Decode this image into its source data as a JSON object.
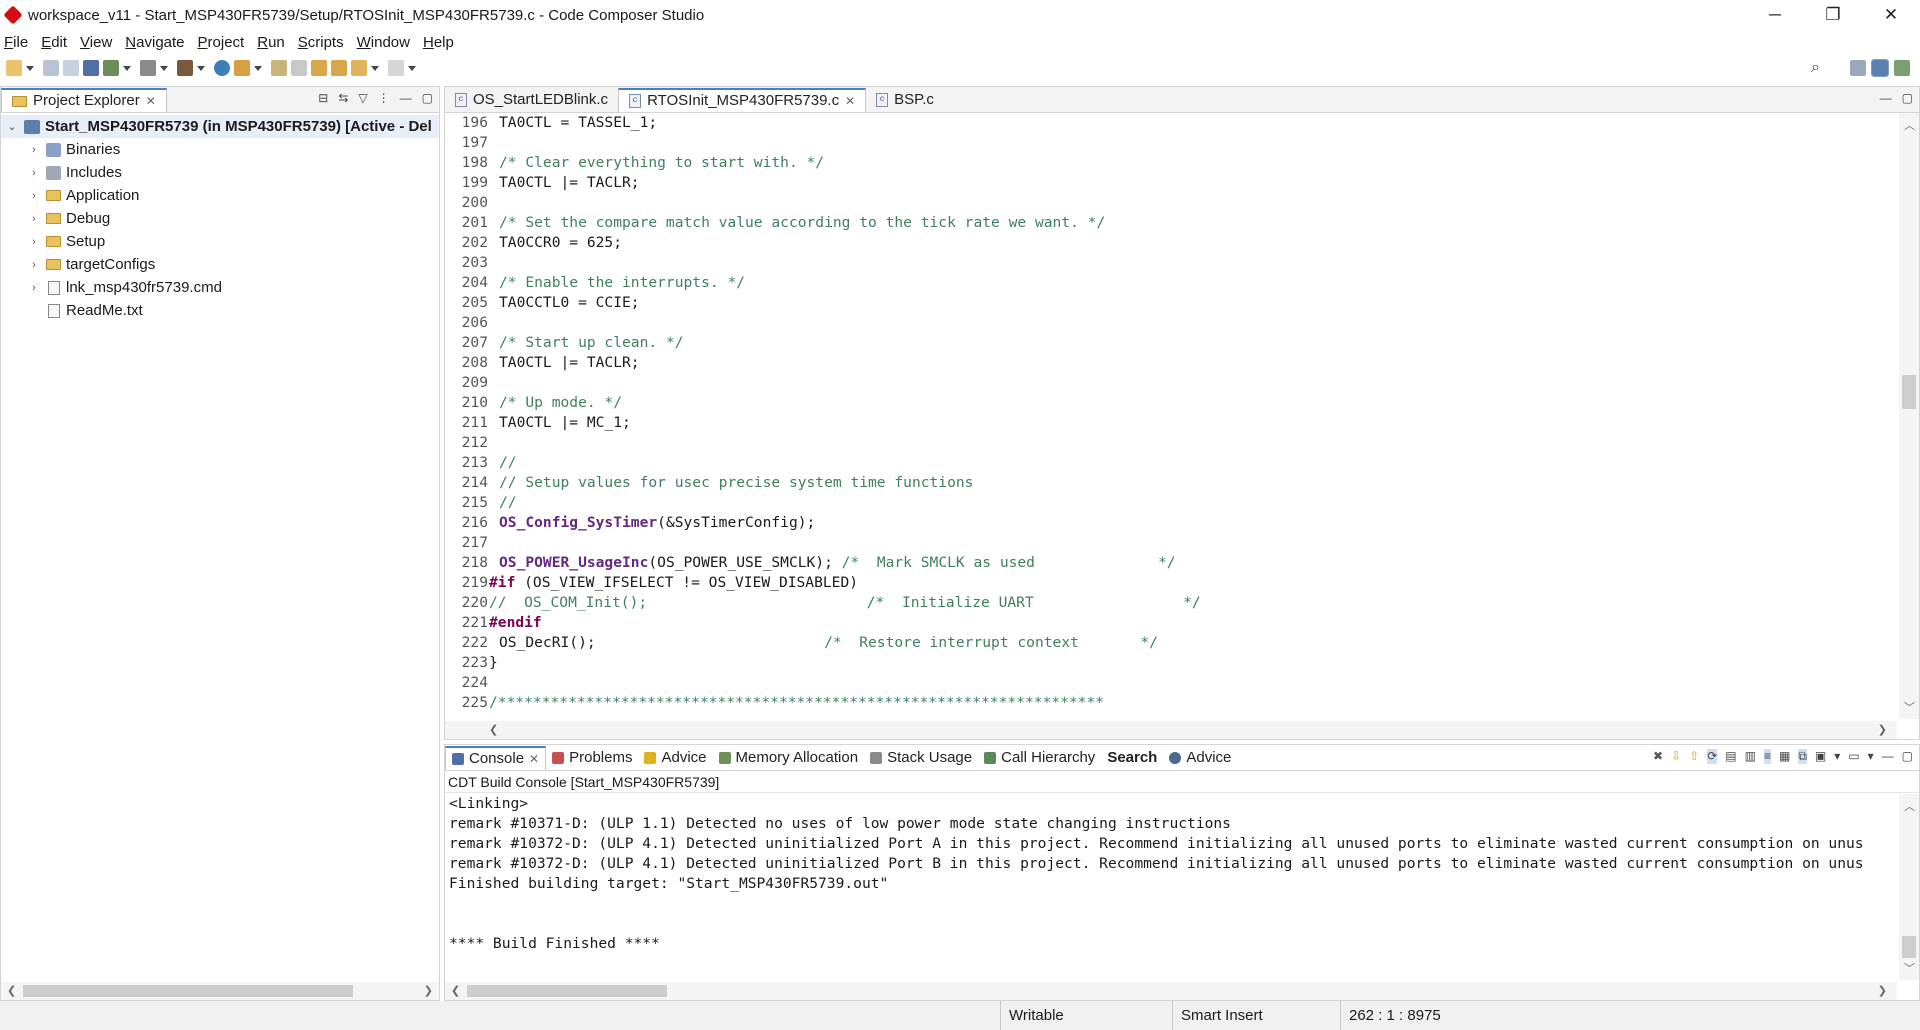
{
  "window": {
    "title": "workspace_v11 - Start_MSP430FR5739/Setup/RTOSInit_MSP430FR5739.c - Code Composer Studio",
    "minimize": "─",
    "maximize": "❐",
    "close": "✕"
  },
  "menu": [
    "File",
    "Edit",
    "View",
    "Navigate",
    "Project",
    "Run",
    "Scripts",
    "Window",
    "Help"
  ],
  "explorer": {
    "tab": "Project Explorer",
    "tab_close": "✕",
    "project": "Start_MSP430FR5739 (in MSP430FR5739)  [Active - Del",
    "items": [
      {
        "label": "Binaries",
        "icon": "binaries-icon",
        "expandable": true
      },
      {
        "label": "Includes",
        "icon": "includes-icon",
        "expandable": true
      },
      {
        "label": "Application",
        "icon": "folder-icon",
        "expandable": true
      },
      {
        "label": "Debug",
        "icon": "folder-icon",
        "expandable": true
      },
      {
        "label": "Setup",
        "icon": "folder-icon",
        "expandable": true
      },
      {
        "label": "targetConfigs",
        "icon": "folder-icon",
        "expandable": true
      },
      {
        "label": "lnk_msp430fr5739.cmd",
        "icon": "file-icon",
        "expandable": true
      },
      {
        "label": "ReadMe.txt",
        "icon": "file-icon",
        "expandable": false
      }
    ]
  },
  "editor": {
    "tabs": [
      {
        "label": "OS_StartLEDBlink.c",
        "active": false
      },
      {
        "label": "RTOSInit_MSP430FR5739.c",
        "active": true,
        "close": "✕"
      },
      {
        "label": "BSP.c",
        "active": false
      }
    ],
    "lines": [
      {
        "n": "196",
        "text": "TA0CTL = TASSEL_1;",
        "type": "code"
      },
      {
        "n": "197",
        "text": "",
        "type": "code"
      },
      {
        "n": "198",
        "text": "/* Clear everything to start with. */",
        "type": "cmt"
      },
      {
        "n": "199",
        "text": "TA0CTL |= TACLR;",
        "type": "code"
      },
      {
        "n": "200",
        "text": "",
        "type": "code"
      },
      {
        "n": "201",
        "text": "/* Set the compare match value according to the tick rate we want. */",
        "type": "cmt"
      },
      {
        "n": "202",
        "text": "TA0CCR0 = 625;",
        "type": "code"
      },
      {
        "n": "203",
        "text": "",
        "type": "code"
      },
      {
        "n": "204",
        "text": "/* Enable the interrupts. */",
        "type": "cmt"
      },
      {
        "n": "205",
        "text": "TA0CCTL0 = CCIE;",
        "type": "code"
      },
      {
        "n": "206",
        "text": "",
        "type": "code"
      },
      {
        "n": "207",
        "text": "/* Start up clean. */",
        "type": "cmt"
      },
      {
        "n": "208",
        "text": "TA0CTL |= TACLR;",
        "type": "code"
      },
      {
        "n": "209",
        "text": "",
        "type": "code"
      },
      {
        "n": "210",
        "text": "/* Up mode. */",
        "type": "cmt"
      },
      {
        "n": "211",
        "text": "TA0CTL |= MC_1;",
        "type": "code"
      },
      {
        "n": "212",
        "text": "",
        "type": "code"
      },
      {
        "n": "213",
        "text": "//",
        "type": "cmt"
      },
      {
        "n": "214",
        "text": "// Setup values for usec precise system time functions",
        "type": "cmt"
      },
      {
        "n": "215",
        "text": "//",
        "type": "cmt"
      },
      {
        "n": "216",
        "text": "OS_Config_SysTimer(&SysTimerConfig);",
        "type": "call",
        "fn": "OS_Config_SysTimer",
        "rest": "(&SysTimerConfig);"
      },
      {
        "n": "217",
        "text": "",
        "type": "code"
      },
      {
        "n": "218",
        "text": "OS_POWER_UsageInc(OS_POWER_USE_SMCLK); /*  Mark SMCLK as used              */",
        "type": "callcmt",
        "fn": "OS_POWER_UsageInc",
        "rest": "(OS_POWER_USE_SMCLK); ",
        "cmt": "/*  Mark SMCLK as used              */"
      },
      {
        "n": "219",
        "text": "#if (OS_VIEW_IFSELECT != OS_VIEW_DISABLED)",
        "type": "pp",
        "kw": "#if",
        "rest": " (OS_VIEW_IFSELECT != OS_VIEW_DISABLED)"
      },
      {
        "n": "220",
        "text": "//  OS_COM_Init();                         /*  Initialize UART                 */",
        "type": "ppcmt"
      },
      {
        "n": "221",
        "text": "#endif",
        "type": "ppkw"
      },
      {
        "n": "222",
        "text": "OS_DecRI();                          /*  Restore interrupt context       */",
        "type": "codecmt",
        "code": "OS_DecRI();                          ",
        "cmt": "/*  Restore interrupt context       */"
      },
      {
        "n": "223",
        "text": "}",
        "type": "pptext"
      },
      {
        "n": "224",
        "text": "",
        "type": "code"
      },
      {
        "n": "225",
        "text": "/*********************************************************************",
        "type": "ppcmt"
      }
    ]
  },
  "console": {
    "tabs": [
      {
        "label": "Console",
        "icon": "console-icon",
        "active": true
      },
      {
        "label": "Problems",
        "icon": "problems-icon"
      },
      {
        "label": "Advice",
        "icon": "bulb-icon"
      },
      {
        "label": "Memory Allocation",
        "icon": "memory-icon"
      },
      {
        "label": "Stack Usage",
        "icon": "stack-icon"
      },
      {
        "label": "Call Hierarchy",
        "icon": "hierarchy-icon"
      },
      {
        "label": "Search",
        "icon": "",
        "bold": true
      },
      {
        "label": "Advice",
        "icon": "globe-icon"
      }
    ],
    "subtitle": "CDT Build Console [Start_MSP430FR5739]",
    "lines": [
      "<Linking>",
      "remark #10371-D: (ULP 1.1) Detected no uses of low power mode state changing instructions",
      "remark #10372-D: (ULP 4.1) Detected uninitialized Port A in this project. Recommend initializing all unused ports to eliminate wasted current consumption on unus",
      "remark #10372-D: (ULP 4.1) Detected uninitialized Port B in this project. Recommend initializing all unused ports to eliminate wasted current consumption on unus",
      "Finished building target: \"Start_MSP430FR5739.out\"",
      "",
      "",
      "**** Build Finished ****"
    ]
  },
  "status": {
    "writable": "Writable",
    "insert_mode": "Smart Insert",
    "position": "262 : 1 : 8975"
  }
}
